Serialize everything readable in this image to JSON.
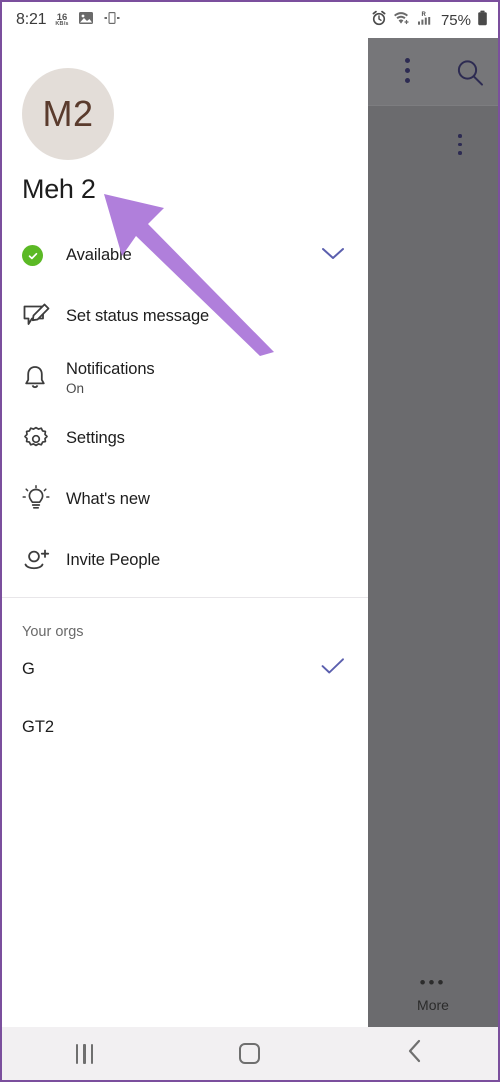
{
  "status_bar": {
    "time": "8:21",
    "data_rate_value": "16",
    "data_rate_unit": "KB/s",
    "icons": [
      "image-icon",
      "vibrate-icon",
      "alarm-icon",
      "wifi-icon",
      "signal-roaming-icon"
    ],
    "battery_percent": "75%",
    "roaming_label": "R"
  },
  "drawer": {
    "avatar_initials": "M2",
    "profile_name": "Meh 2",
    "menu": [
      {
        "label": "Available",
        "sub": "",
        "icon": "available-status-icon",
        "trailing": "chevron-down-icon"
      },
      {
        "label": "Set status message",
        "sub": "",
        "icon": "edit-message-icon",
        "trailing": ""
      },
      {
        "label": "Notifications",
        "sub": "On",
        "icon": "bell-icon",
        "trailing": ""
      },
      {
        "label": "Settings",
        "sub": "",
        "icon": "gear-icon",
        "trailing": ""
      },
      {
        "label": "What's new",
        "sub": "",
        "icon": "lightbulb-icon",
        "trailing": ""
      },
      {
        "label": "Invite People",
        "sub": "",
        "icon": "person-add-icon",
        "trailing": ""
      }
    ],
    "orgs_title": "Your orgs",
    "orgs": [
      {
        "name": "G",
        "selected": true
      },
      {
        "name": "GT2",
        "selected": false
      }
    ]
  },
  "background_app": {
    "more_tab_label": "More",
    "search_icon": "search-icon",
    "overflow_icon": "kebab-menu-icon"
  },
  "nav_bar": {
    "recents_label": "Recents",
    "home_label": "Home",
    "back_label": "Back"
  },
  "colors": {
    "accent_purple": "#5B5FAE",
    "status_green": "#5BB925",
    "avatar_bg": "#E3DDD8",
    "avatar_fg": "#5A3B2D",
    "overlay_gray": "#6B6B6E",
    "pointer_arrow": "#B07FDB"
  }
}
